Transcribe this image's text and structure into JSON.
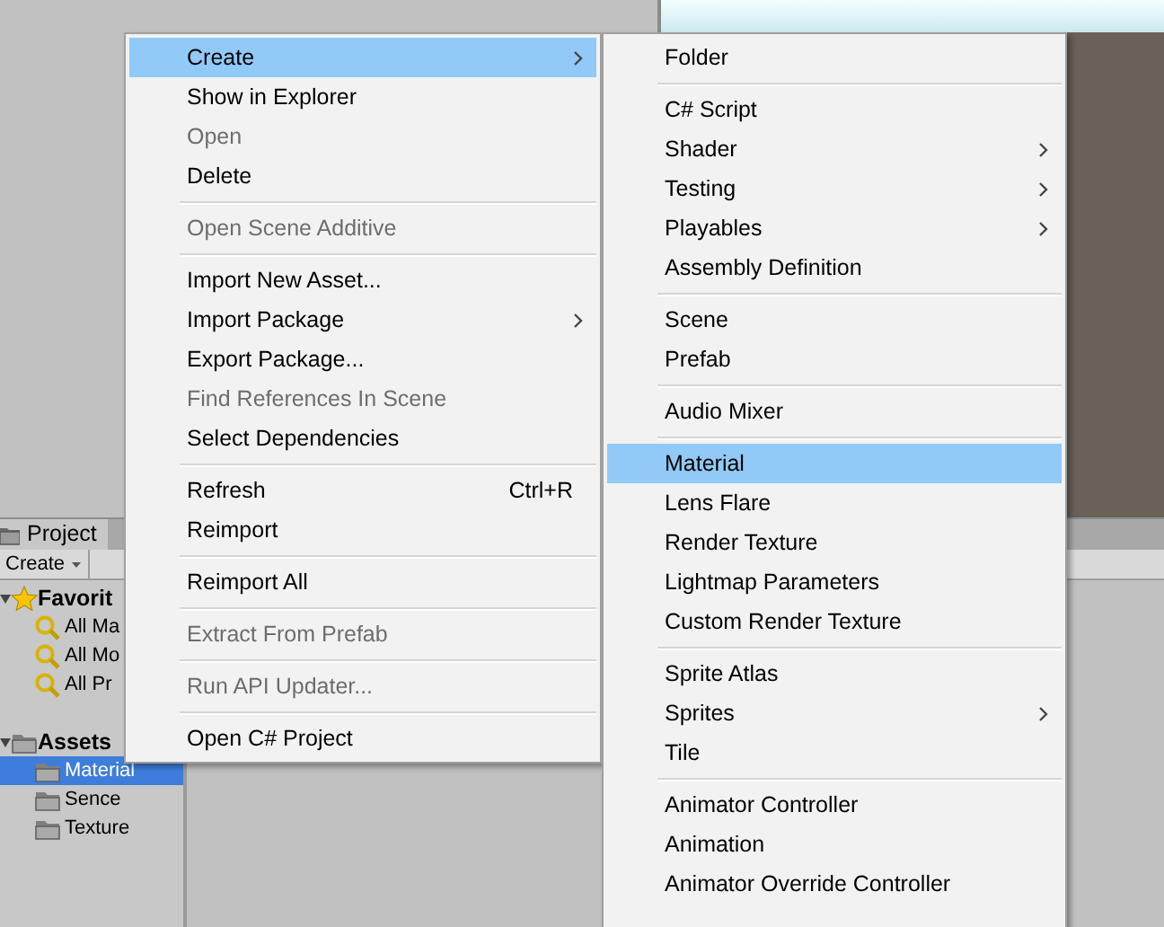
{
  "project_panel": {
    "tab": "Project",
    "create_button": "Create",
    "tree": [
      {
        "label": "Favorit",
        "kind": "favorites",
        "expanded": true,
        "children": [
          {
            "label": "All Ma",
            "kind": "search",
            "selected": false
          },
          {
            "label": "All Mo",
            "kind": "search",
            "selected": false
          },
          {
            "label": "All Pr",
            "kind": "search",
            "selected": false
          }
        ]
      },
      {
        "label": "Assets",
        "kind": "folder",
        "expanded": true,
        "children": [
          {
            "label": "Material",
            "kind": "folder",
            "selected": true
          },
          {
            "label": "Sence",
            "kind": "folder",
            "selected": false
          },
          {
            "label": "Texture",
            "kind": "folder",
            "selected": false
          }
        ]
      }
    ]
  },
  "context_menu": {
    "items": [
      {
        "kind": "item",
        "label": "Create",
        "disabled": false,
        "submenu": true,
        "selected": true
      },
      {
        "kind": "item",
        "label": "Show in Explorer",
        "disabled": false,
        "submenu": false,
        "selected": false
      },
      {
        "kind": "item",
        "label": "Open",
        "disabled": true,
        "submenu": false,
        "selected": false
      },
      {
        "kind": "item",
        "label": "Delete",
        "disabled": false,
        "submenu": false,
        "selected": false
      },
      {
        "kind": "separator"
      },
      {
        "kind": "item",
        "label": "Open Scene Additive",
        "disabled": true,
        "submenu": false,
        "selected": false
      },
      {
        "kind": "separator"
      },
      {
        "kind": "item",
        "label": "Import New Asset...",
        "disabled": false,
        "submenu": false,
        "selected": false
      },
      {
        "kind": "item",
        "label": "Import Package",
        "disabled": false,
        "submenu": true,
        "selected": false
      },
      {
        "kind": "item",
        "label": "Export Package...",
        "disabled": false,
        "submenu": false,
        "selected": false
      },
      {
        "kind": "item",
        "label": "Find References In Scene",
        "disabled": true,
        "submenu": false,
        "selected": false
      },
      {
        "kind": "item",
        "label": "Select Dependencies",
        "disabled": false,
        "submenu": false,
        "selected": false
      },
      {
        "kind": "separator"
      },
      {
        "kind": "item",
        "label": "Refresh",
        "shortcut": "Ctrl+R",
        "disabled": false,
        "submenu": false,
        "selected": false
      },
      {
        "kind": "item",
        "label": "Reimport",
        "disabled": false,
        "submenu": false,
        "selected": false
      },
      {
        "kind": "separator"
      },
      {
        "kind": "item",
        "label": "Reimport All",
        "disabled": false,
        "submenu": false,
        "selected": false
      },
      {
        "kind": "separator"
      },
      {
        "kind": "item",
        "label": "Extract From Prefab",
        "disabled": true,
        "submenu": false,
        "selected": false
      },
      {
        "kind": "separator"
      },
      {
        "kind": "item",
        "label": "Run API Updater...",
        "disabled": true,
        "submenu": false,
        "selected": false
      },
      {
        "kind": "separator"
      },
      {
        "kind": "item",
        "label": "Open C# Project",
        "disabled": false,
        "submenu": false,
        "selected": false
      }
    ]
  },
  "create_submenu": {
    "items": [
      {
        "kind": "item",
        "label": "Folder",
        "disabled": false,
        "submenu": false,
        "selected": false
      },
      {
        "kind": "separator"
      },
      {
        "kind": "item",
        "label": "C# Script",
        "disabled": false,
        "submenu": false,
        "selected": false
      },
      {
        "kind": "item",
        "label": "Shader",
        "disabled": false,
        "submenu": true,
        "selected": false
      },
      {
        "kind": "item",
        "label": "Testing",
        "disabled": false,
        "submenu": true,
        "selected": false
      },
      {
        "kind": "item",
        "label": "Playables",
        "disabled": false,
        "submenu": true,
        "selected": false
      },
      {
        "kind": "item",
        "label": "Assembly Definition",
        "disabled": false,
        "submenu": false,
        "selected": false
      },
      {
        "kind": "separator"
      },
      {
        "kind": "item",
        "label": "Scene",
        "disabled": false,
        "submenu": false,
        "selected": false
      },
      {
        "kind": "item",
        "label": "Prefab",
        "disabled": false,
        "submenu": false,
        "selected": false
      },
      {
        "kind": "separator"
      },
      {
        "kind": "item",
        "label": "Audio Mixer",
        "disabled": false,
        "submenu": false,
        "selected": false
      },
      {
        "kind": "separator"
      },
      {
        "kind": "item",
        "label": "Material",
        "disabled": false,
        "submenu": false,
        "selected": true
      },
      {
        "kind": "item",
        "label": "Lens Flare",
        "disabled": false,
        "submenu": false,
        "selected": false
      },
      {
        "kind": "item",
        "label": "Render Texture",
        "disabled": false,
        "submenu": false,
        "selected": false
      },
      {
        "kind": "item",
        "label": "Lightmap Parameters",
        "disabled": false,
        "submenu": false,
        "selected": false
      },
      {
        "kind": "item",
        "label": "Custom Render Texture",
        "disabled": false,
        "submenu": false,
        "selected": false
      },
      {
        "kind": "separator"
      },
      {
        "kind": "item",
        "label": "Sprite Atlas",
        "disabled": false,
        "submenu": false,
        "selected": false
      },
      {
        "kind": "item",
        "label": "Sprites",
        "disabled": false,
        "submenu": true,
        "selected": false
      },
      {
        "kind": "item",
        "label": "Tile",
        "disabled": false,
        "submenu": false,
        "selected": false
      },
      {
        "kind": "separator"
      },
      {
        "kind": "item",
        "label": "Animator Controller",
        "disabled": false,
        "submenu": false,
        "selected": false
      },
      {
        "kind": "item",
        "label": "Animation",
        "disabled": false,
        "submenu": false,
        "selected": false
      },
      {
        "kind": "item",
        "label": "Animator Override Controller",
        "disabled": false,
        "submenu": false,
        "selected": false
      }
    ]
  }
}
